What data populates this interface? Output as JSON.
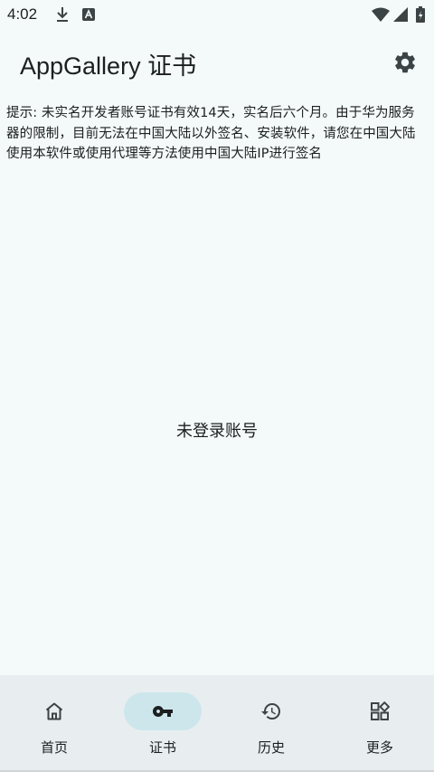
{
  "status_bar": {
    "time": "4:02",
    "icons": [
      "download-icon",
      "text-a-icon",
      "wifi-icon",
      "signal-icon",
      "battery-icon"
    ]
  },
  "app_bar": {
    "title": "AppGallery 证书",
    "settings_icon": "gear-icon"
  },
  "notice": {
    "text": "提示: 未实名开发者账号证书有效14天，实名后六个月。由于华为服务器的限制，目前无法在中国大陆以外签名、安装软件，请您在中国大陆使用本软件或使用代理等方法使用中国大陆IP进行签名"
  },
  "empty_state": {
    "text": "未登录账号"
  },
  "bottom_nav": {
    "items": [
      {
        "label": "首页",
        "icon": "home-icon",
        "active": false
      },
      {
        "label": "证书",
        "icon": "key-icon",
        "active": true
      },
      {
        "label": "历史",
        "icon": "history-icon",
        "active": false
      },
      {
        "label": "更多",
        "icon": "widgets-icon",
        "active": false
      }
    ]
  },
  "colors": {
    "background": "#f4f9fa",
    "nav_background": "#e8eef0",
    "active_indicator": "#cce6ec",
    "text": "#1b1f20"
  }
}
